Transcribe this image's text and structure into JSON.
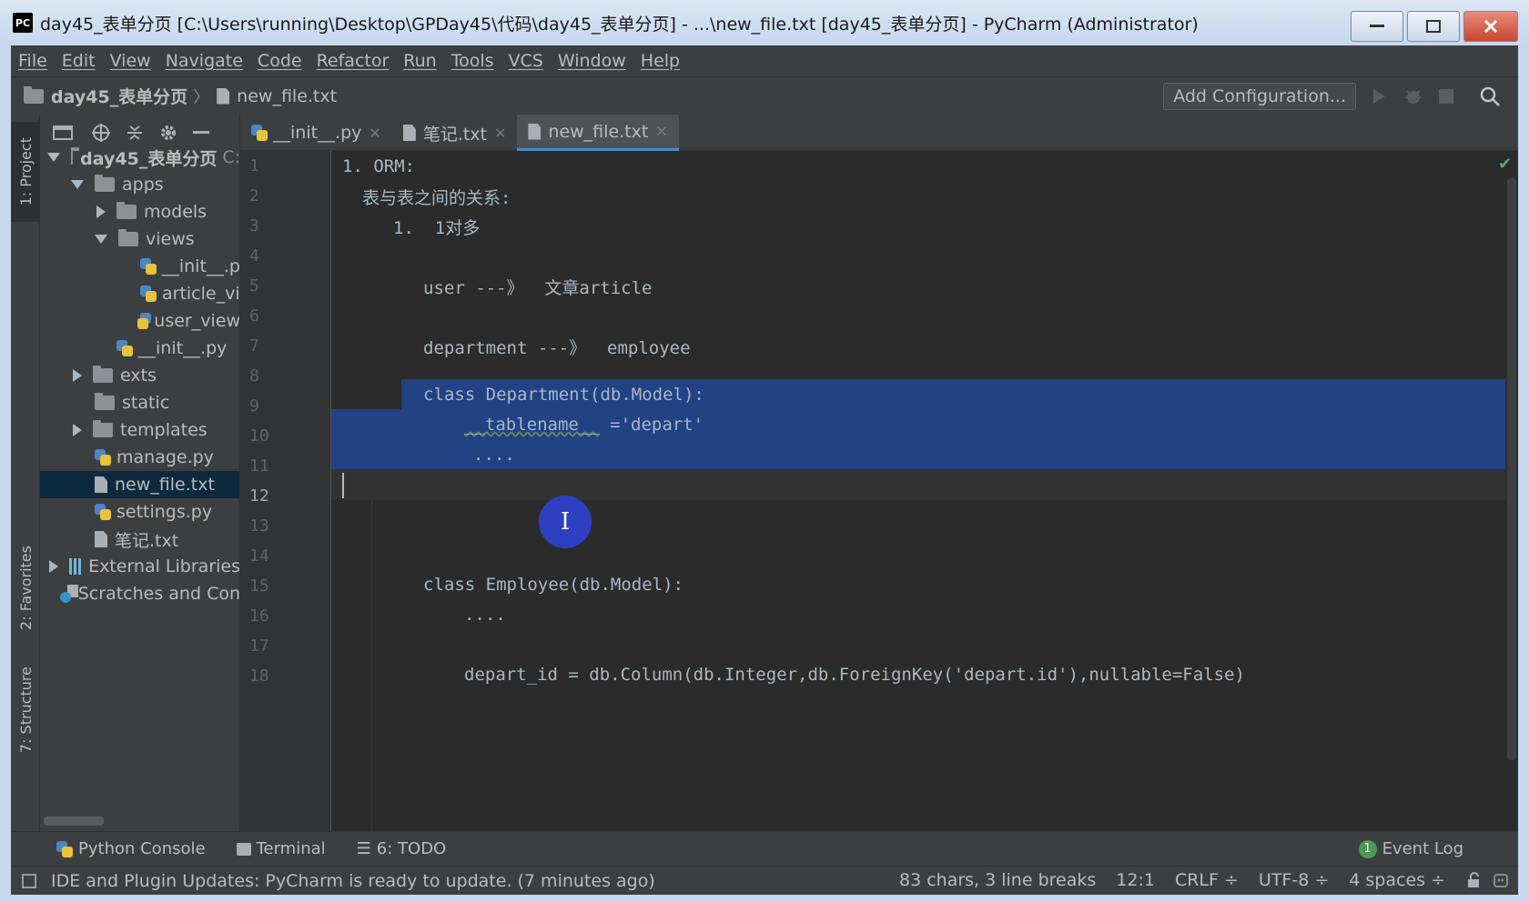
{
  "window": {
    "title": "day45_表单分页 [C:\\Users\\running\\Desktop\\GPDay45\\代码\\day45_表单分页] - ...\\new_file.txt [day45_表单分页] - PyCharm (Administrator)",
    "logo": "PC"
  },
  "menu": [
    "File",
    "Edit",
    "View",
    "Navigate",
    "Code",
    "Refactor",
    "Run",
    "Tools",
    "VCS",
    "Window",
    "Help"
  ],
  "navbar": {
    "project": "day45_表单分页",
    "file": "new_file.txt",
    "add_config": "Add Configuration..."
  },
  "left_strip": {
    "project_tab": "1: Project",
    "favorites_tab": "2: Favorites",
    "structure_tab": "7: Structure"
  },
  "tree": [
    {
      "label": "day45_表单分页",
      "suffix": "C:",
      "bold": true
    },
    {
      "label": "apps"
    },
    {
      "label": "models"
    },
    {
      "label": "views"
    },
    {
      "label": "__init__.p"
    },
    {
      "label": "article_vi"
    },
    {
      "label": "user_view"
    },
    {
      "label": "__init__.py"
    },
    {
      "label": "exts"
    },
    {
      "label": "static"
    },
    {
      "label": "templates"
    },
    {
      "label": "manage.py"
    },
    {
      "label": "new_file.txt"
    },
    {
      "label": "settings.py"
    },
    {
      "label": "笔记.txt"
    },
    {
      "label": "External Libraries"
    },
    {
      "label": "Scratches and Con"
    }
  ],
  "tabs": [
    "__init__.py",
    "笔记.txt",
    "new_file.txt"
  ],
  "line_numbers": [
    "1",
    "2",
    "3",
    "4",
    "5",
    "6",
    "7",
    "8",
    "9",
    "10",
    "11",
    "12",
    "13",
    "14",
    "15",
    "16",
    "17",
    "18"
  ],
  "code": [
    "1. ORM:",
    "表与表之间的关系:",
    "1.  1对多",
    "",
    "user ---》  文章article",
    "",
    "department ---》  employee",
    "",
    "class Department(db.Model):",
    "__tablename__",
    "='depart'",
    "....",
    "",
    "",
    "",
    "class Employee(db.Model):",
    "....",
    "",
    "depart_id = db.Column(db.Integer,db.ForeignKey('depart.id'),nullable=False)"
  ],
  "cursor_glyph": "I",
  "bottom_tools": {
    "python_console": "Python Console",
    "terminal": "Terminal",
    "todo": "6: TODO",
    "event_count": "1",
    "event_log": "Event Log"
  },
  "status": {
    "message": "IDE and Plugin Updates: PyCharm is ready to update. (7 minutes ago)",
    "chars": "83 chars, 3 line breaks",
    "position": "12:1",
    "line_sep": "CRLF ÷",
    "encoding": "UTF-8 ÷",
    "indent": "4 spaces ÷"
  },
  "colors": {
    "editor_bg": "#2b2b2b",
    "panel_bg": "#3c3f41",
    "selection": "#214283",
    "accent": "#4a88c7"
  }
}
